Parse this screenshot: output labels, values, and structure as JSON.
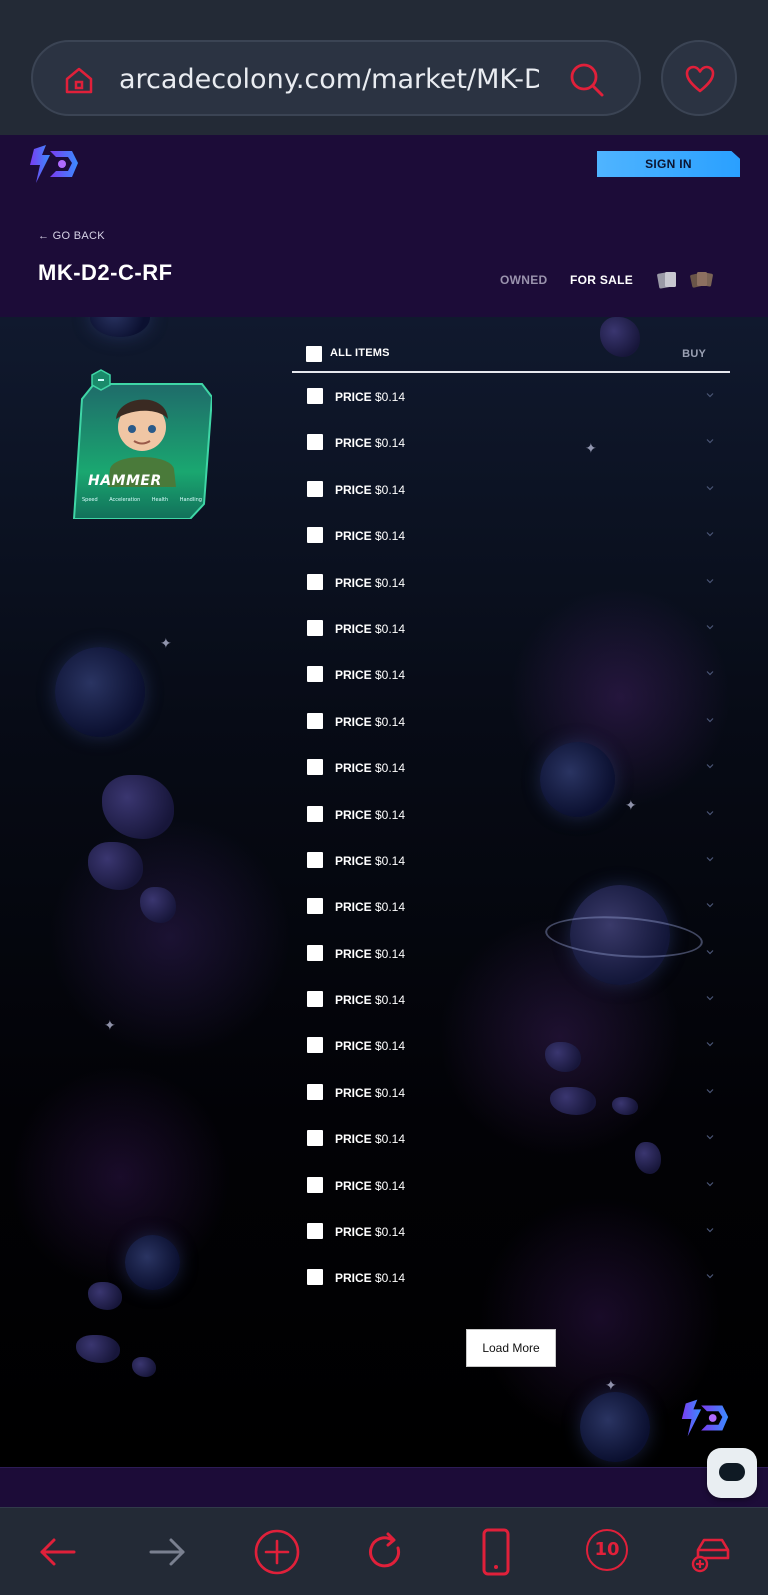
{
  "browser": {
    "url": "arcadecolony.com/market/MK-D2-C-RF",
    "tab_count": "10"
  },
  "header": {
    "sign_in_label": "SIGN IN",
    "go_back_label": "← GO BACK",
    "title": "MK-D2-C-RF",
    "tabs": {
      "owned": "OWNED",
      "for_sale": "FOR SALE"
    }
  },
  "card": {
    "name": "HAMMER",
    "stats": [
      "Speed",
      "Acceleration",
      "Health",
      "Handling"
    ]
  },
  "list": {
    "all_items_label": "ALL ITEMS",
    "buy_label": "BUY",
    "rows": [
      {
        "label": "PRICE",
        "value": "$0.14"
      },
      {
        "label": "PRICE",
        "value": "$0.14"
      },
      {
        "label": "PRICE",
        "value": "$0.14"
      },
      {
        "label": "PRICE",
        "value": "$0.14"
      },
      {
        "label": "PRICE",
        "value": "$0.14"
      },
      {
        "label": "PRICE",
        "value": "$0.14"
      },
      {
        "label": "PRICE",
        "value": "$0.14"
      },
      {
        "label": "PRICE",
        "value": "$0.14"
      },
      {
        "label": "PRICE",
        "value": "$0.14"
      },
      {
        "label": "PRICE",
        "value": "$0.14"
      },
      {
        "label": "PRICE",
        "value": "$0.14"
      },
      {
        "label": "PRICE",
        "value": "$0.14"
      },
      {
        "label": "PRICE",
        "value": "$0.14"
      },
      {
        "label": "PRICE",
        "value": "$0.14"
      },
      {
        "label": "PRICE",
        "value": "$0.14"
      },
      {
        "label": "PRICE",
        "value": "$0.14"
      },
      {
        "label": "PRICE",
        "value": "$0.14"
      },
      {
        "label": "PRICE",
        "value": "$0.14"
      },
      {
        "label": "PRICE",
        "value": "$0.14"
      },
      {
        "label": "PRICE",
        "value": "$0.14"
      }
    ],
    "load_more_label": "Load More"
  },
  "colors": {
    "browser_bg": "#232a36",
    "accent_red": "#e0203a",
    "site_header_bg": "#1c0c38",
    "sign_in_bg": "#2aa0ff"
  },
  "icons": {
    "home": "home-icon",
    "search": "search-icon",
    "favorite": "heart-icon",
    "back": "arrow-left-icon",
    "forward": "arrow-right-icon",
    "new_tab": "plus-circle-icon",
    "reload": "reload-icon",
    "device": "phone-icon",
    "tabs": "tabs-count-icon",
    "extensions": "car-add-icon",
    "chat": "chat-icon"
  }
}
